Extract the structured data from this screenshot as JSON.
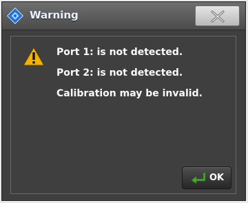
{
  "window": {
    "title": "Warning",
    "app_icon": "diamond-logo-icon",
    "close_icon": "close-x-icon"
  },
  "message": {
    "icon": "warning-triangle-icon",
    "lines": [
      "Port 1: is not detected.",
      "Port 2: is not detected.",
      "Calibration may be invalid."
    ]
  },
  "buttons": {
    "ok_label": "OK",
    "ok_icon": "enter-arrow-icon"
  },
  "colors": {
    "dialog_bg": "#3f3f3f",
    "text": "#fafafa",
    "warning_yellow": "#f2b300",
    "ok_arrow_green": "#4fa53a"
  }
}
